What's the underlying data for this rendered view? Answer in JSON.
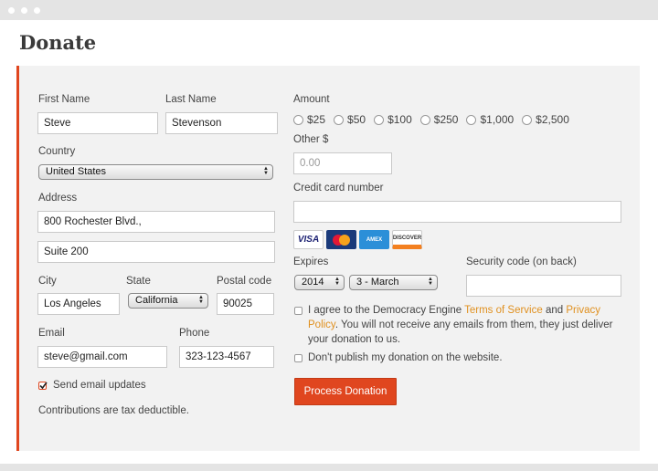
{
  "page_title": "Donate",
  "form": {
    "first_name_label": "First Name",
    "first_name_value": "Steve",
    "last_name_label": "Last Name",
    "last_name_value": "Stevenson",
    "country_label": "Country",
    "country_value": "United States",
    "address_label": "Address",
    "address1_value": "800 Rochester Blvd.,",
    "address2_value": "Suite 200",
    "city_label": "City",
    "city_value": "Los Angeles",
    "state_label": "State",
    "state_value": "California",
    "postal_label": "Postal code",
    "postal_value": "90025",
    "email_label": "Email",
    "email_value": "steve@gmail.com",
    "phone_label": "Phone",
    "phone_value": "323-123-4567",
    "send_updates_label": "Send email updates",
    "send_updates_checked": true,
    "tax_note": "Contributions are tax deductible."
  },
  "payment": {
    "amount_label": "Amount",
    "amounts": [
      "$25",
      "$50",
      "$100",
      "$250",
      "$1,000",
      "$2,500"
    ],
    "other_label": "Other $",
    "other_placeholder": "0.00",
    "cc_label": "Credit card number",
    "cards": [
      "VISA",
      "MasterCard",
      "AMERICAN EXPRESS",
      "DISCOVER"
    ],
    "expires_label": "Expires",
    "expires_year": "2014",
    "expires_month": "3 - March",
    "security_label": "Security code (on back)",
    "agree_prefix": "I agree to the Democracy Engine ",
    "terms_link": "Terms of Service",
    "agree_and": " and ",
    "privacy_link": "Privacy Policy",
    "agree_suffix": ". You will not receive any emails from them, they just deliver your donation to us.",
    "no_publish_label": "Don't publish my donation on the website.",
    "submit_label": "Process Donation"
  },
  "colors": {
    "accent": "#e0461f",
    "link": "#e0901f"
  }
}
